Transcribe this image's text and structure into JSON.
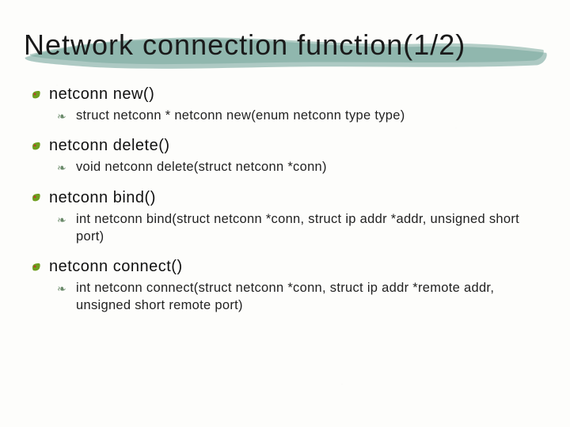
{
  "title": "Network connection function(1/2)",
  "bullet_main_color": "#6e9e1e",
  "bullet_main_dot": "#c0392b",
  "items": [
    {
      "head": "netconn new()",
      "sub": "struct netconn * netconn new(enum netconn type type)"
    },
    {
      "head": "netconn delete()",
      "sub": "void netconn delete(struct netconn *conn)"
    },
    {
      "head": "netconn bind()",
      "sub": "int netconn bind(struct netconn *conn, struct ip addr *addr, unsigned short port)"
    },
    {
      "head": "netconn connect()",
      "sub": "int netconn connect(struct netconn *conn, struct ip addr *remote addr, unsigned short remote port)"
    }
  ]
}
